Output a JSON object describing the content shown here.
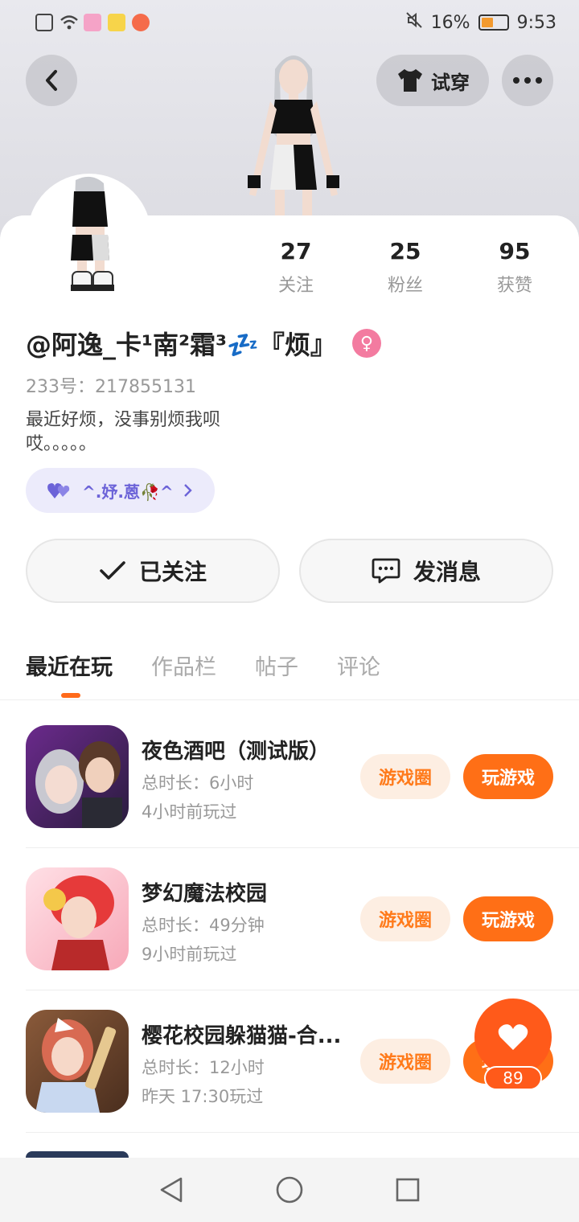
{
  "status": {
    "battery": "16%",
    "time": "9:53"
  },
  "header": {
    "try_on_label": "试穿"
  },
  "profile": {
    "stats": [
      {
        "num": "27",
        "label": "关注"
      },
      {
        "num": "25",
        "label": "粉丝"
      },
      {
        "num": "95",
        "label": "获赞"
      }
    ],
    "nickname": "@阿逸_卡¹南²霜³💤『烦』",
    "uid": "233号：217855131",
    "bio": "最近好烦，没事别烦我呗哎。。。。。",
    "relation": "^.妤.蒽🥀^",
    "follow_label": "已关注",
    "message_label": "发消息"
  },
  "tabs": [
    "最近在玩",
    "作品栏",
    "帖子",
    "评论"
  ],
  "games": [
    {
      "name": "夜色酒吧（测试版）",
      "duration": "总时长：6小时",
      "last": "4小时前玩过",
      "circle": "游戏圈",
      "play": "玩游戏"
    },
    {
      "name": "梦幻魔法校园",
      "duration": "总时长：49分钟",
      "last": "9小时前玩过",
      "circle": "游戏圈",
      "play": "玩游戏"
    },
    {
      "name": "樱花校园躲猫猫-合...",
      "duration": "总时长：12小时",
      "last": "昨天 17:30玩过",
      "circle": "游戏圈",
      "play": "玩游戏"
    }
  ],
  "like": {
    "count": "89"
  },
  "colors": {
    "accent": "#ff6f16",
    "relation": "#6c63d8",
    "gender": "#f37ba0"
  }
}
